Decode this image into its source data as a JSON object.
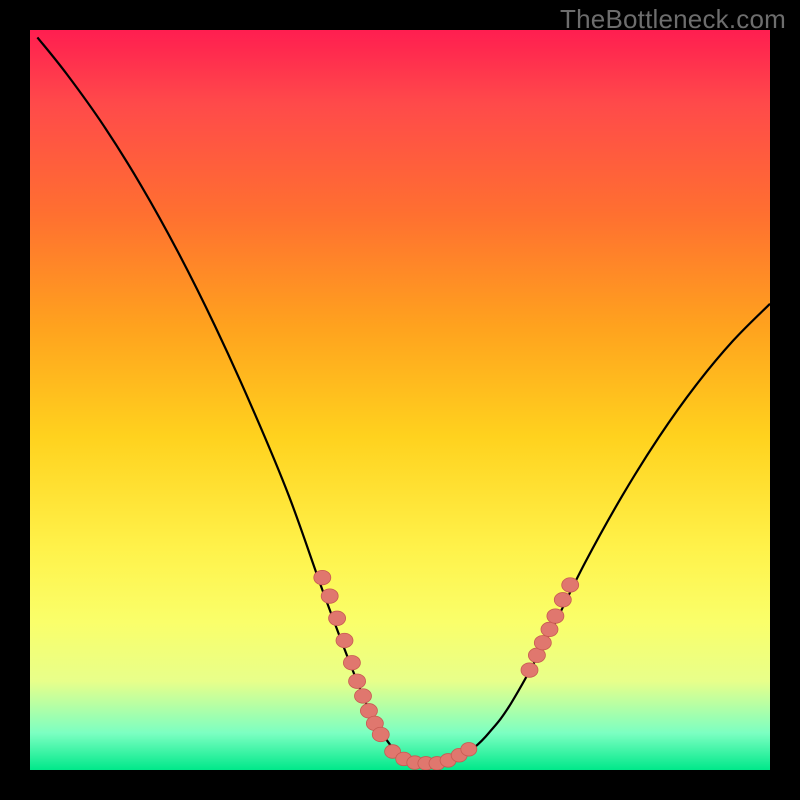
{
  "watermark": "TheBottleneck.com",
  "colors": {
    "frame": "#000000",
    "gradient_top": "#ff1e50",
    "gradient_bottom": "#00e88a",
    "curve": "#000000",
    "beads": "#e0776e",
    "bead_stroke": "#c85a52"
  },
  "chart_data": {
    "type": "line",
    "title": "",
    "xlabel": "",
    "ylabel": "",
    "xlim": [
      0,
      100
    ],
    "ylim": [
      0,
      100
    ],
    "note": "Axes are unlabeled; values are visual estimates in 0–100 plot-area units. y=0 is bottom (green), y=100 is top (red).",
    "series": [
      {
        "name": "v-curve",
        "x": [
          1,
          5,
          10,
          15,
          20,
          25,
          30,
          35,
          40,
          45,
          47,
          49,
          51,
          53,
          55,
          57,
          59,
          60,
          62,
          65,
          70,
          75,
          80,
          85,
          90,
          95,
          100
        ],
        "y": [
          99,
          94,
          87,
          79,
          70,
          60,
          49,
          37,
          23,
          10,
          6,
          3,
          1.5,
          1,
          1,
          1.5,
          2.5,
          3,
          5,
          9,
          18,
          28,
          37,
          45,
          52,
          58,
          63
        ]
      }
    ],
    "beads_left": [
      {
        "x": 39.5,
        "y": 26.0
      },
      {
        "x": 40.5,
        "y": 23.5
      },
      {
        "x": 41.5,
        "y": 20.5
      },
      {
        "x": 42.5,
        "y": 17.5
      },
      {
        "x": 43.5,
        "y": 14.5
      },
      {
        "x": 44.2,
        "y": 12.0
      },
      {
        "x": 45.0,
        "y": 10.0
      },
      {
        "x": 45.8,
        "y": 8.0
      },
      {
        "x": 46.6,
        "y": 6.3
      },
      {
        "x": 47.4,
        "y": 4.8
      }
    ],
    "beads_bottom": [
      {
        "x": 49.0,
        "y": 2.5
      },
      {
        "x": 50.5,
        "y": 1.5
      },
      {
        "x": 52.0,
        "y": 1.0
      },
      {
        "x": 53.5,
        "y": 0.9
      },
      {
        "x": 55.0,
        "y": 0.9
      },
      {
        "x": 56.5,
        "y": 1.3
      },
      {
        "x": 58.0,
        "y": 2.0
      },
      {
        "x": 59.3,
        "y": 2.8
      }
    ],
    "beads_right": [
      {
        "x": 67.5,
        "y": 13.5
      },
      {
        "x": 68.5,
        "y": 15.5
      },
      {
        "x": 69.3,
        "y": 17.2
      },
      {
        "x": 70.2,
        "y": 19.0
      },
      {
        "x": 71.0,
        "y": 20.8
      },
      {
        "x": 72.0,
        "y": 23.0
      },
      {
        "x": 73.0,
        "y": 25.0
      }
    ]
  }
}
